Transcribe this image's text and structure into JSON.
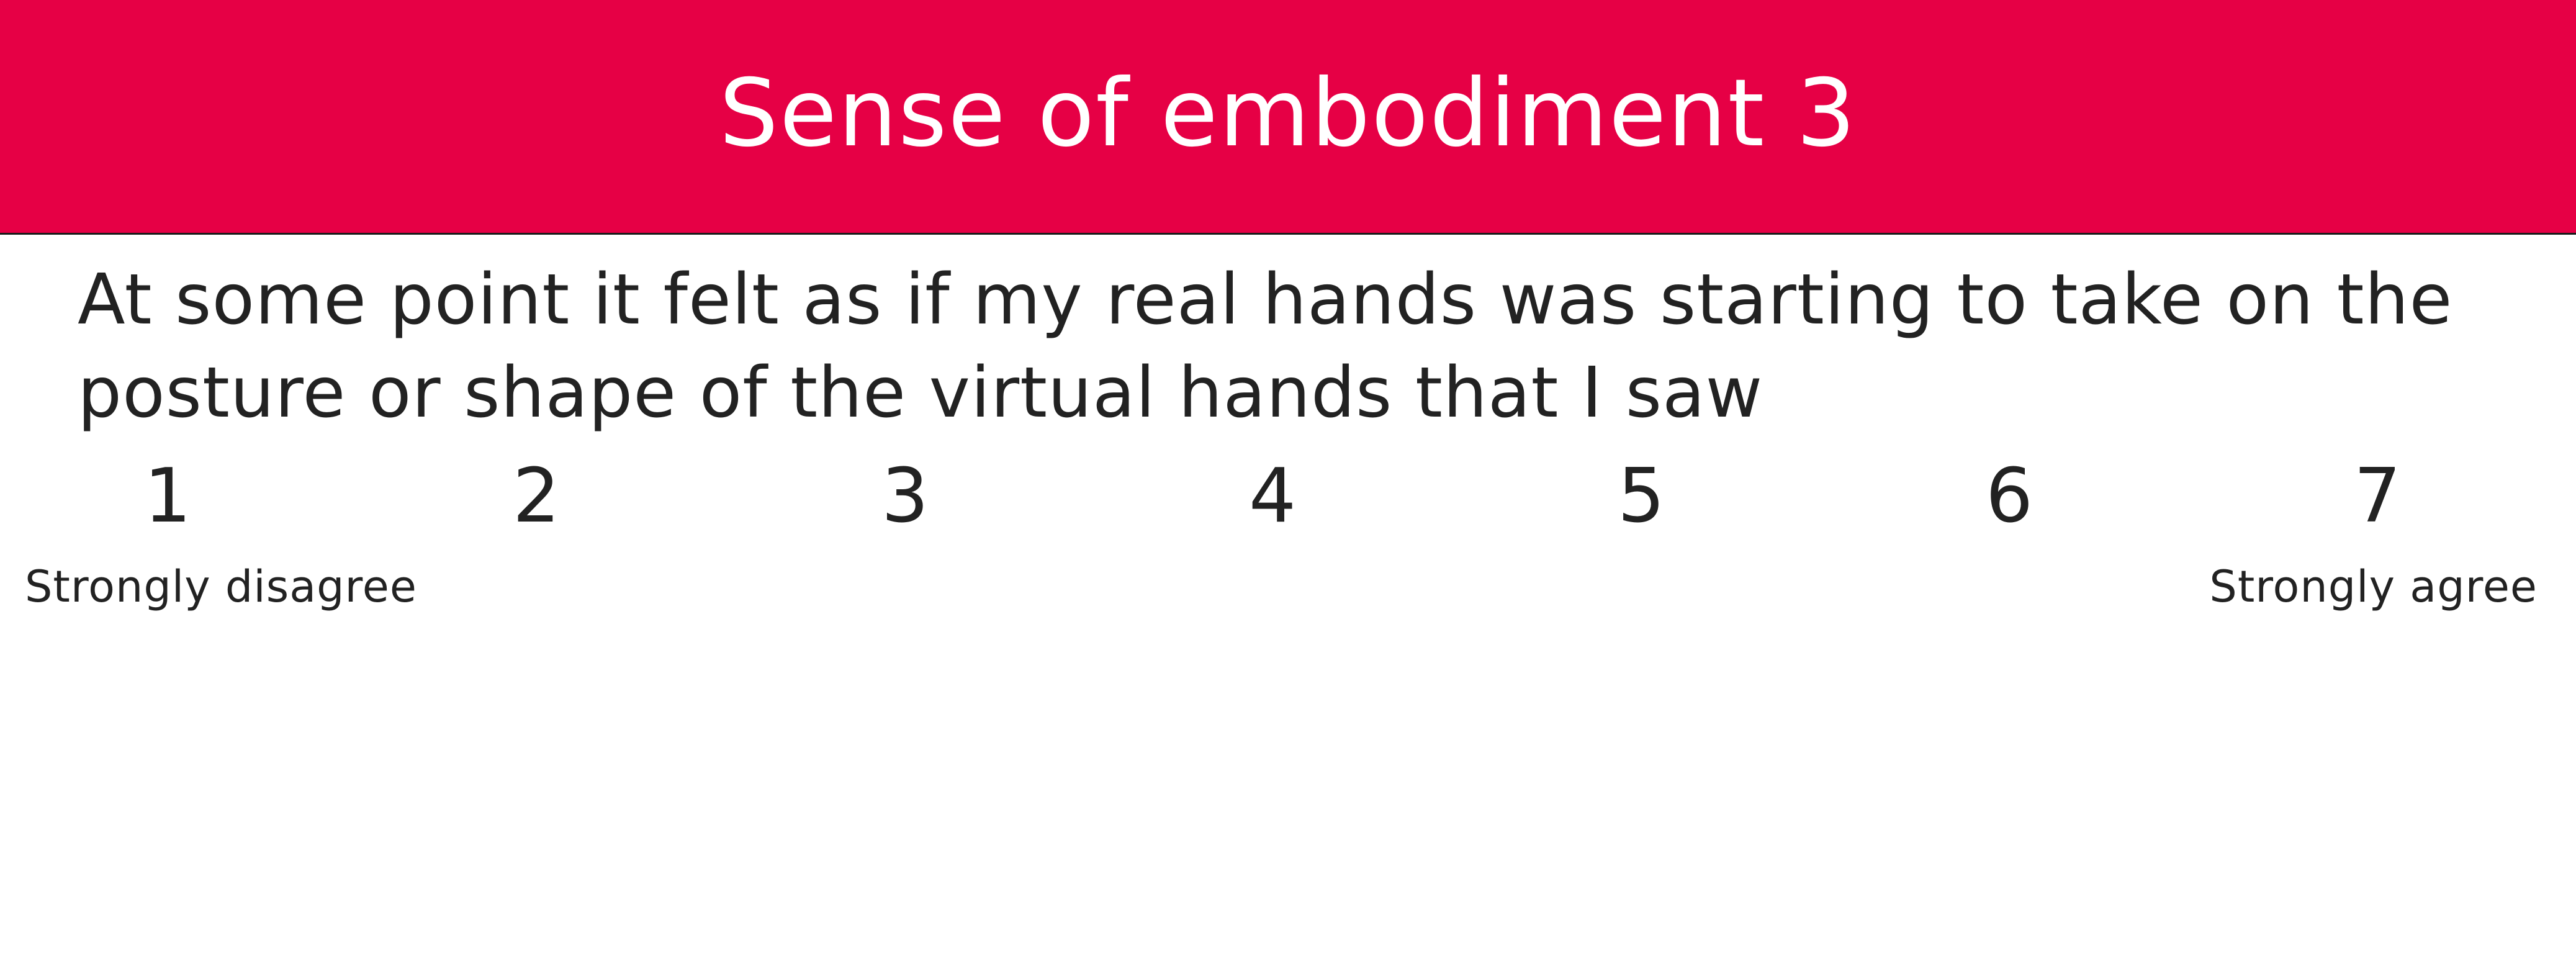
{
  "header": {
    "title": "Sense of embodiment 3",
    "background_color": "#e60045"
  },
  "question": {
    "text": "At some point it felt as if my real hands was starting to take on the posture or shape of the virtual hands that I saw"
  },
  "scale": {
    "options": [
      "1",
      "2",
      "3",
      "4",
      "5",
      "6",
      "7"
    ],
    "min_label": "Strongly disagree",
    "max_label": "Strongly agree"
  }
}
